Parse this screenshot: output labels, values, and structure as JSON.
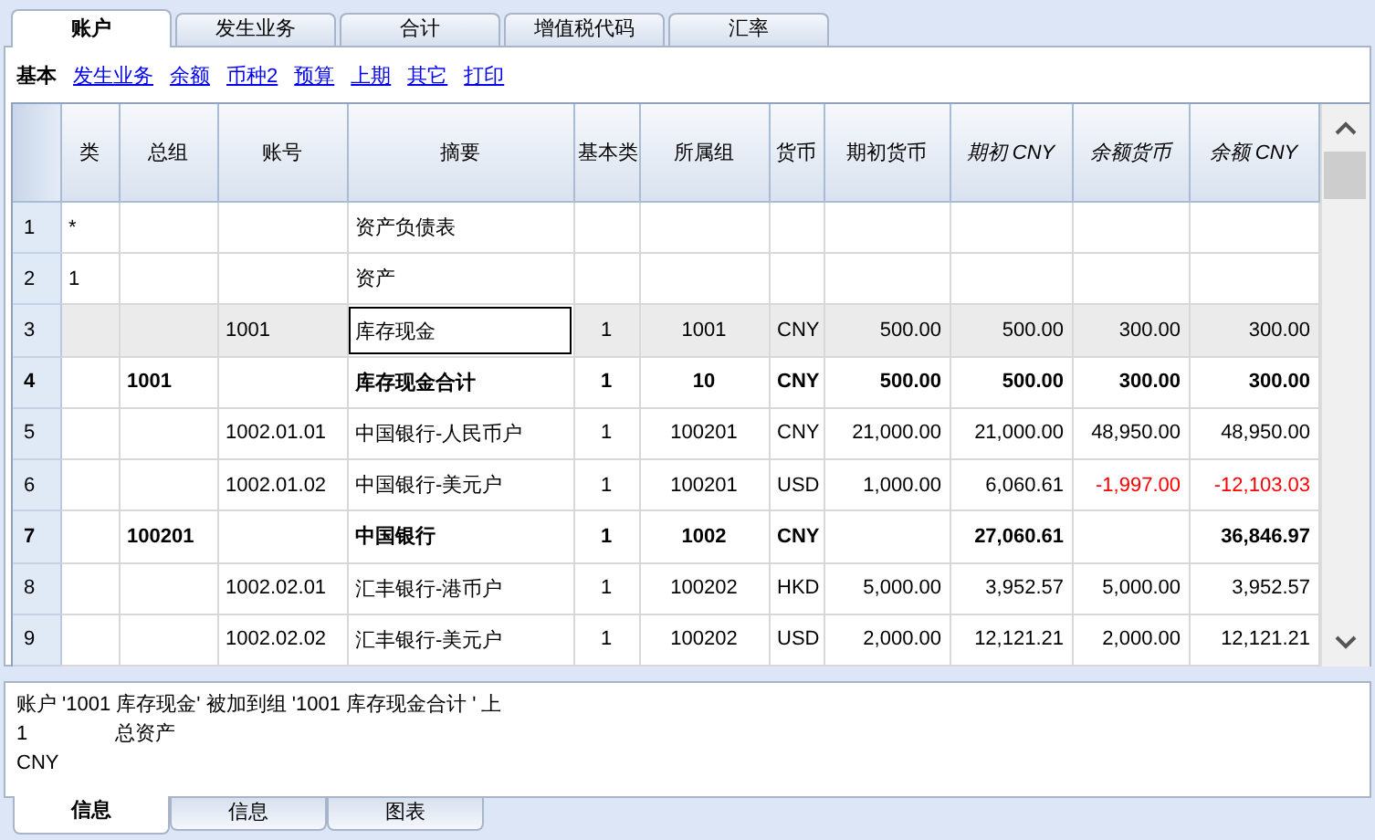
{
  "tabs": [
    {
      "label": "账户",
      "selected": true
    },
    {
      "label": "发生业务",
      "selected": false
    },
    {
      "label": "合计",
      "selected": false
    },
    {
      "label": "增值税代码",
      "selected": false
    },
    {
      "label": "汇率",
      "selected": false
    }
  ],
  "views": [
    {
      "label": "基本",
      "selected": true
    },
    {
      "label": "发生业务",
      "selected": false
    },
    {
      "label": "余额",
      "selected": false
    },
    {
      "label": "币种2",
      "selected": false
    },
    {
      "label": "预算",
      "selected": false
    },
    {
      "label": "上期",
      "selected": false
    },
    {
      "label": "其它",
      "selected": false
    },
    {
      "label": "打印",
      "selected": false
    }
  ],
  "table": {
    "columns": [
      {
        "label": "类",
        "italic": false
      },
      {
        "label": "总组",
        "italic": false
      },
      {
        "label": "账号",
        "italic": false
      },
      {
        "label": "摘要",
        "italic": false
      },
      {
        "label": "基本类",
        "italic": false
      },
      {
        "label": "所属组",
        "italic": false
      },
      {
        "label": "货币",
        "italic": false
      },
      {
        "label": "期初货币",
        "italic": false
      },
      {
        "label": "期初 CNY",
        "italic": true
      },
      {
        "label": "余额货币",
        "italic": true
      },
      {
        "label": "余额 CNY",
        "italic": true
      }
    ],
    "rows": [
      {
        "number": "1",
        "bold": false,
        "selected": false,
        "cells": [
          "*",
          "",
          "",
          "资产负债表",
          "",
          "",
          "",
          "",
          "",
          "",
          ""
        ]
      },
      {
        "number": "2",
        "bold": false,
        "selected": false,
        "cells": [
          "1",
          "",
          "",
          "资产",
          "",
          "",
          "",
          "",
          "",
          "",
          ""
        ]
      },
      {
        "number": "3",
        "bold": false,
        "selected": true,
        "negative_balance": false,
        "cells": [
          "",
          "",
          "1001",
          "库存现金",
          "1",
          "1001",
          "CNY",
          "500.00",
          "500.00",
          "300.00",
          "300.00"
        ]
      },
      {
        "number": "4",
        "bold": true,
        "selected": false,
        "negative_balance": false,
        "cells": [
          "",
          "1001",
          "",
          "库存现金合计",
          "1",
          "10",
          "CNY",
          "500.00",
          "500.00",
          "300.00",
          "300.00"
        ]
      },
      {
        "number": "5",
        "bold": false,
        "selected": false,
        "negative_balance": false,
        "cells": [
          "",
          "",
          "1002.01.01",
          "中国银行-人民币户",
          "1",
          "100201",
          "CNY",
          "21,000.00",
          "21,000.00",
          "48,950.00",
          "48,950.00"
        ]
      },
      {
        "number": "6",
        "bold": false,
        "selected": false,
        "negative_balance": true,
        "cells": [
          "",
          "",
          "1002.01.02",
          "中国银行-美元户",
          "1",
          "100201",
          "USD",
          "1,000.00",
          "6,060.61",
          "-1,997.00",
          "-12,103.03"
        ]
      },
      {
        "number": "7",
        "bold": true,
        "selected": false,
        "negative_balance": false,
        "cells": [
          "",
          "100201",
          "",
          "中国银行",
          "1",
          "1002",
          "CNY",
          "",
          "27,060.61",
          "",
          "36,846.97"
        ]
      },
      {
        "number": "8",
        "bold": false,
        "selected": false,
        "negative_balance": false,
        "cells": [
          "",
          "",
          "1002.02.01",
          "汇丰银行-港币户",
          "1",
          "100202",
          "HKD",
          "5,000.00",
          "3,952.57",
          "5,000.00",
          "3,952.57"
        ]
      },
      {
        "number": "9",
        "bold": false,
        "selected": false,
        "negative_balance": false,
        "cells": [
          "",
          "",
          "1002.02.02",
          "汇丰银行-美元户",
          "1",
          "100202",
          "USD",
          "2,000.00",
          "12,121.21",
          "2,000.00",
          "12,121.21"
        ]
      }
    ]
  },
  "info": {
    "lines": [
      [
        "账户 '1001 库存现金' 被加到组 '1001 库存现金合计 ' 上"
      ],
      [
        "1",
        "总资产"
      ],
      [
        "CNY"
      ]
    ]
  },
  "bottom_tabs": [
    {
      "label": "信息",
      "selected": true
    },
    {
      "label": "信息",
      "selected": false
    },
    {
      "label": "图表",
      "selected": false
    }
  ]
}
